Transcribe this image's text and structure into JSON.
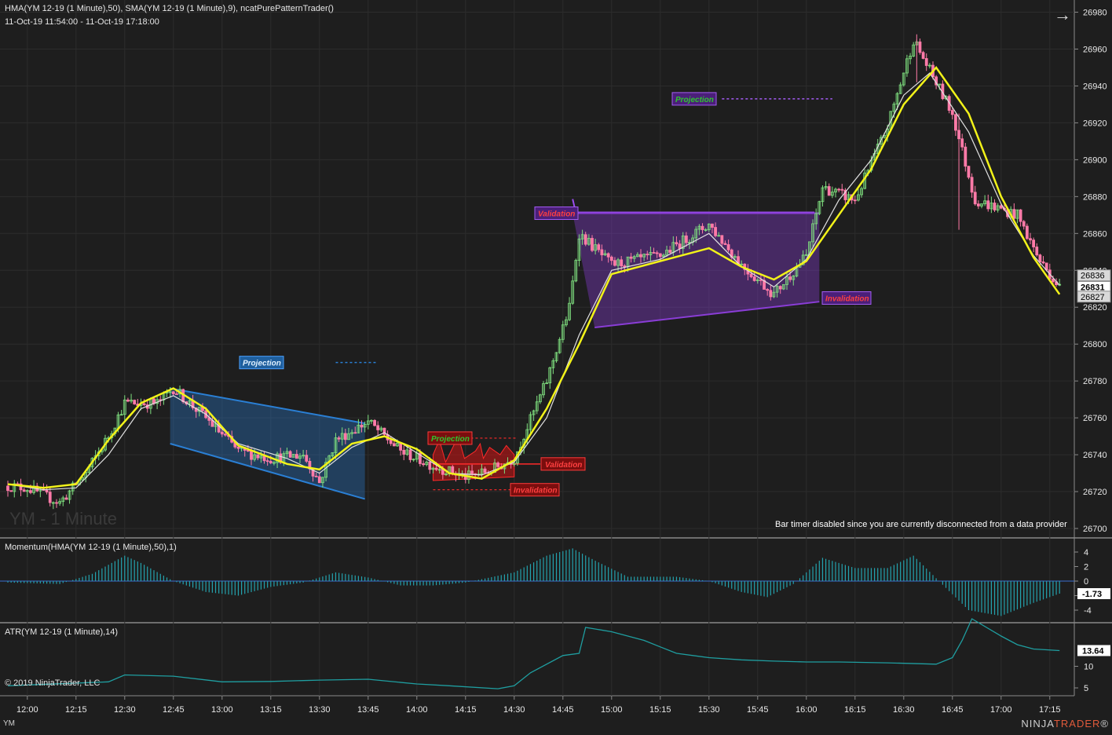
{
  "window": {
    "instrument": "YM",
    "watermark": "YM - 1 Minute",
    "indicators_line": "HMA(YM 12-19 (1 Minute),50), SMA(YM 12-19 (1 Minute),9), ncatPurePatternTrader()",
    "date_range": "11-Oct-19 11:54:00 - 11-Oct-19 17:18:00",
    "notice": "Bar timer disabled since you are currently disconnected from a data provider",
    "copyright": "© 2019 NinjaTrader, LLC",
    "brand_prefix": "NINJA",
    "brand_suffix": "TRADER",
    "brand_mark": "®",
    "arrow_icon": "arrow-right-icon"
  },
  "colors": {
    "background": "#1e1e1e",
    "up_candle": "#7fe07f",
    "down_candle": "#ff7aa8",
    "hma": "#f2f219",
    "sma": "#e0e0e0",
    "momentum": "#24a2ad",
    "atr": "#1f9ea0",
    "blue_pattern": "#2a7fd4",
    "red_pattern": "#d21414",
    "purple_pattern": "#8a3dd6"
  },
  "chart_data": [
    {
      "type": "candlestick",
      "panel": "price",
      "x_ticks": [
        "12:00",
        "12:15",
        "12:30",
        "12:45",
        "13:00",
        "13:15",
        "13:30",
        "13:45",
        "14:00",
        "14:15",
        "14:30",
        "14:45",
        "15:00",
        "15:15",
        "15:30",
        "15:45",
        "16:00",
        "16:15",
        "16:30",
        "16:45",
        "17:00",
        "17:15"
      ],
      "y_ticks": [
        26700,
        26720,
        26740,
        26760,
        26780,
        26800,
        26820,
        26840,
        26860,
        26880,
        26900,
        26920,
        26940,
        26960,
        26980
      ],
      "ylim": [
        26693,
        26986
      ],
      "price_labels": [
        {
          "label": "26836",
          "value": 26836
        },
        {
          "label": "26831",
          "value": 26831
        },
        {
          "label": "26827",
          "value": 26827
        }
      ],
      "close_path": [
        [
          "11:54",
          26723
        ],
        [
          "12:00",
          26722
        ],
        [
          "12:10",
          26714
        ],
        [
          "12:18",
          26730
        ],
        [
          "12:25",
          26750
        ],
        [
          "12:30",
          26768
        ],
        [
          "12:40",
          26768
        ],
        [
          "12:45",
          26776
        ],
        [
          "12:55",
          26760
        ],
        [
          "13:05",
          26742
        ],
        [
          "13:15",
          26738
        ],
        [
          "13:25",
          26740
        ],
        [
          "13:30",
          26725
        ],
        [
          "13:35",
          26748
        ],
        [
          "13:45",
          26758
        ],
        [
          "13:55",
          26742
        ],
        [
          "14:05",
          26734
        ],
        [
          "14:15",
          26728
        ],
        [
          "14:22",
          26731
        ],
        [
          "14:30",
          26738
        ],
        [
          "14:40",
          26780
        ],
        [
          "14:47",
          26820
        ],
        [
          "14:50",
          26860
        ],
        [
          "15:00",
          26843
        ],
        [
          "15:15",
          26848
        ],
        [
          "15:30",
          26865
        ],
        [
          "15:40",
          26843
        ],
        [
          "15:50",
          26827
        ],
        [
          "16:00",
          26848
        ],
        [
          "16:05",
          26885
        ],
        [
          "16:15",
          26878
        ],
        [
          "16:25",
          26918
        ],
        [
          "16:33",
          26965
        ],
        [
          "16:45",
          26925
        ],
        [
          "16:52",
          26878
        ],
        [
          "17:05",
          26870
        ],
        [
          "17:12",
          26845
        ],
        [
          "17:18",
          26831
        ]
      ],
      "hma_path": [
        [
          "11:54",
          26724
        ],
        [
          "12:05",
          26722
        ],
        [
          "12:15",
          26724
        ],
        [
          "12:25",
          26748
        ],
        [
          "12:35",
          26768
        ],
        [
          "12:45",
          26776
        ],
        [
          "12:55",
          26765
        ],
        [
          "13:05",
          26745
        ],
        [
          "13:20",
          26735
        ],
        [
          "13:30",
          26732
        ],
        [
          "13:40",
          26746
        ],
        [
          "13:50",
          26750
        ],
        [
          "14:00",
          26743
        ],
        [
          "14:10",
          26730
        ],
        [
          "14:20",
          26727
        ],
        [
          "14:30",
          26737
        ],
        [
          "14:40",
          26765
        ],
        [
          "14:50",
          26800
        ],
        [
          "15:00",
          26838
        ],
        [
          "15:15",
          26845
        ],
        [
          "15:30",
          26852
        ],
        [
          "15:40",
          26842
        ],
        [
          "15:50",
          26835
        ],
        [
          "16:00",
          26845
        ],
        [
          "16:10",
          26870
        ],
        [
          "16:20",
          26895
        ],
        [
          "16:30",
          26930
        ],
        [
          "16:40",
          26950
        ],
        [
          "16:50",
          26925
        ],
        [
          "17:00",
          26880
        ],
        [
          "17:10",
          26847
        ],
        [
          "17:18",
          26827
        ]
      ],
      "sma_path": [
        [
          "11:54",
          26724
        ],
        [
          "12:05",
          26721
        ],
        [
          "12:15",
          26722
        ],
        [
          "12:25",
          26740
        ],
        [
          "12:35",
          26765
        ],
        [
          "12:45",
          26772
        ],
        [
          "12:55",
          26762
        ],
        [
          "13:05",
          26746
        ],
        [
          "13:20",
          26738
        ],
        [
          "13:30",
          26730
        ],
        [
          "13:40",
          26744
        ],
        [
          "13:50",
          26752
        ],
        [
          "14:00",
          26741
        ],
        [
          "14:10",
          26730
        ],
        [
          "14:20",
          26729
        ],
        [
          "14:30",
          26736
        ],
        [
          "14:40",
          26760
        ],
        [
          "14:50",
          26805
        ],
        [
          "15:00",
          26840
        ],
        [
          "15:15",
          26846
        ],
        [
          "15:30",
          26860
        ],
        [
          "15:40",
          26842
        ],
        [
          "15:50",
          26831
        ],
        [
          "16:00",
          26846
        ],
        [
          "16:10",
          26878
        ],
        [
          "16:20",
          26900
        ],
        [
          "16:30",
          26935
        ],
        [
          "16:38",
          26947
        ],
        [
          "16:50",
          26915
        ],
        [
          "17:00",
          26876
        ],
        [
          "17:10",
          26848
        ],
        [
          "17:18",
          26832
        ]
      ],
      "patterns": [
        {
          "color": "blue",
          "t_start": "12:44",
          "t_end": "13:44",
          "top": [
            26776,
            26757
          ],
          "bottom": [
            26746,
            26716
          ],
          "projection_label": "Projection",
          "projection_value": 26790,
          "projection_t": [
            "13:35",
            "13:48"
          ]
        },
        {
          "color": "red",
          "t_start": "14:05",
          "t_end": "14:30",
          "top_value": 26734,
          "bottom_value": 26726,
          "projection_label": "Projection",
          "projection_value": 26749,
          "validation_label": "Validation",
          "validation_value": 26735,
          "invalidation_label": "Invalidation",
          "invalidation_value": 26721
        },
        {
          "color": "purple",
          "t_start": "14:48",
          "t_end": "16:04",
          "top_value": 26871,
          "bottom_left": 26809,
          "bottom_right": 26823,
          "projection_label": "Projection",
          "projection_value": 26933,
          "projection_t": [
            "15:34",
            "15:48"
          ],
          "validation_label": "Validation",
          "validation_value": 26872,
          "invalidation_label": "Invalidation",
          "invalidation_value": 26825
        }
      ]
    },
    {
      "type": "bar",
      "panel": "momentum",
      "title": "Momentum(HMA(YM 12-19 (1 Minute),50),1)",
      "y_ticks": [
        4,
        2,
        0,
        -2,
        -4
      ],
      "ylim": [
        -5,
        5.5
      ],
      "last_value_label": "-1.73",
      "last_value": -1.73,
      "profile": [
        [
          "11:54",
          -0.2
        ],
        [
          "12:10",
          -0.4
        ],
        [
          "12:20",
          1.0
        ],
        [
          "12:30",
          3.5
        ],
        [
          "12:35",
          2.5
        ],
        [
          "12:45",
          0.0
        ],
        [
          "12:55",
          -1.5
        ],
        [
          "13:05",
          -2.0
        ],
        [
          "13:15",
          -0.8
        ],
        [
          "13:25",
          -0.2
        ],
        [
          "13:35",
          1.2
        ],
        [
          "13:45",
          0.5
        ],
        [
          "13:55",
          -0.6
        ],
        [
          "14:05",
          -0.6
        ],
        [
          "14:15",
          -0.2
        ],
        [
          "14:30",
          1.2
        ],
        [
          "14:40",
          3.5
        ],
        [
          "14:48",
          4.5
        ],
        [
          "14:55",
          2.8
        ],
        [
          "15:05",
          0.6
        ],
        [
          "15:20",
          0.6
        ],
        [
          "15:30",
          0.0
        ],
        [
          "15:40",
          -1.5
        ],
        [
          "15:48",
          -2.2
        ],
        [
          "15:56",
          -0.4
        ],
        [
          "16:05",
          3.2
        ],
        [
          "16:15",
          1.8
        ],
        [
          "16:25",
          1.8
        ],
        [
          "16:33",
          3.5
        ],
        [
          "16:42",
          -0.5
        ],
        [
          "16:50",
          -4.0
        ],
        [
          "17:00",
          -4.8
        ],
        [
          "17:10",
          -3.0
        ],
        [
          "17:18",
          -1.73
        ]
      ]
    },
    {
      "type": "line",
      "panel": "atr",
      "title": "ATR(YM 12-19 (1 Minute),14)",
      "y_ticks": [
        5,
        10
      ],
      "ylim": [
        3,
        24
      ],
      "last_value_label": "13.64",
      "last_value": 13.64,
      "values": [
        [
          "11:54",
          5.5
        ],
        [
          "12:25",
          6.4
        ],
        [
          "12:30",
          8.0
        ],
        [
          "12:45",
          7.7
        ],
        [
          "13:00",
          6.4
        ],
        [
          "13:15",
          6.5
        ],
        [
          "13:30",
          6.8
        ],
        [
          "13:45",
          7.0
        ],
        [
          "14:00",
          5.9
        ],
        [
          "14:10",
          5.5
        ],
        [
          "14:25",
          4.8
        ],
        [
          "14:30",
          5.5
        ],
        [
          "14:35",
          8.5
        ],
        [
          "14:45",
          12.5
        ],
        [
          "14:50",
          13.0
        ],
        [
          "14:52",
          19.0
        ],
        [
          "15:00",
          18.0
        ],
        [
          "15:10",
          16.0
        ],
        [
          "15:15",
          14.5
        ],
        [
          "15:20",
          13.0
        ],
        [
          "15:30",
          12.0
        ],
        [
          "15:40",
          11.5
        ],
        [
          "15:50",
          11.2
        ],
        [
          "16:00",
          11.0
        ],
        [
          "16:10",
          11.0
        ],
        [
          "16:25",
          10.8
        ],
        [
          "16:40",
          10.5
        ],
        [
          "16:45",
          12.0
        ],
        [
          "16:48",
          16.0
        ],
        [
          "16:51",
          21.0
        ],
        [
          "17:00",
          17.0
        ],
        [
          "17:05",
          15.0
        ],
        [
          "17:10",
          14.0
        ],
        [
          "17:18",
          13.64
        ]
      ]
    }
  ]
}
